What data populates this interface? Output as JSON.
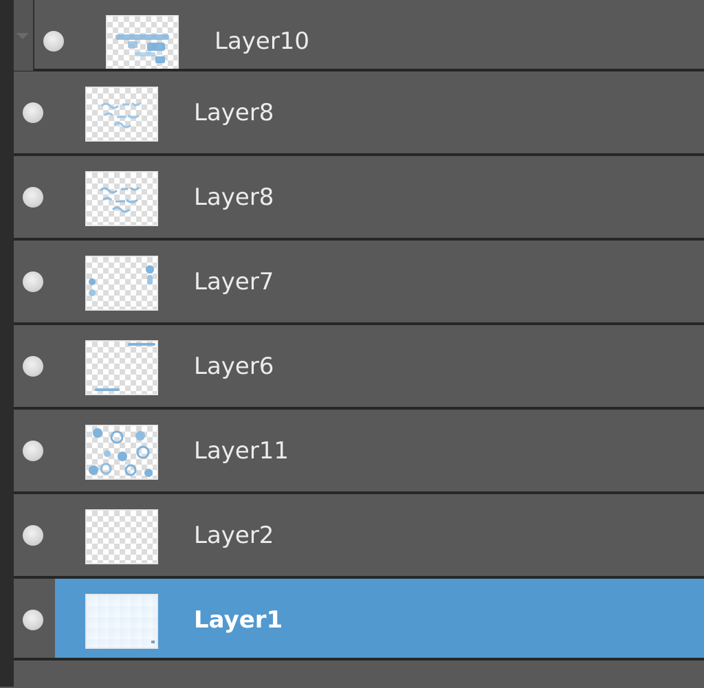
{
  "panel": {
    "name": "layers-panel",
    "selected_color": "#5299cf",
    "row_color": "#595959",
    "separator_color": "#262626"
  },
  "layers": [
    {
      "label": "Layer10",
      "thumb": "top-bar",
      "group_child": true,
      "selected": false
    },
    {
      "label": "Layer8",
      "thumb": "text-block",
      "group_child": false,
      "selected": false
    },
    {
      "label": "Layer8",
      "thumb": "text-block",
      "group_child": false,
      "selected": false
    },
    {
      "label": "Layer7",
      "thumb": "side-dots",
      "group_child": false,
      "selected": false
    },
    {
      "label": "Layer6",
      "thumb": "edge-lines",
      "group_child": false,
      "selected": false
    },
    {
      "label": "Layer11",
      "thumb": "bubbles",
      "group_child": false,
      "selected": false
    },
    {
      "label": "Layer2",
      "thumb": "empty",
      "group_child": false,
      "selected": false
    },
    {
      "label": "Layer1",
      "thumb": "solid",
      "group_child": false,
      "selected": true
    }
  ]
}
